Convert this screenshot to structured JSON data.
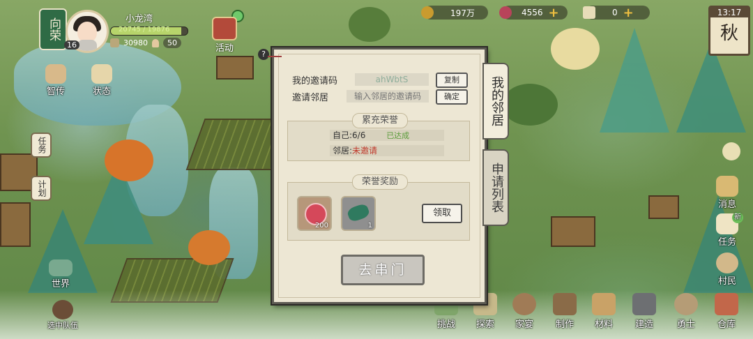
{
  "player": {
    "title": "向荣",
    "name": "小龙湾",
    "level": "16",
    "exp_text": "20745 / 19876",
    "exp_fraction": 0.92,
    "coins": "30980",
    "people": "50"
  },
  "top_resources": {
    "copper": "197万",
    "gem": "4556",
    "ticket": "0",
    "plus": "+"
  },
  "clock": {
    "time": "13:17",
    "season": "秋"
  },
  "activity_label": "活动",
  "help_label": "?",
  "left_menu": {
    "wisdom": "智传",
    "status": "状态",
    "task_tab": "任务",
    "plan_tab": "计划",
    "world": "世界",
    "team": "选中队伍"
  },
  "right_menu": {
    "message": "消息",
    "task": "任务",
    "task_badge": "新",
    "villager": "村民"
  },
  "bottom_menu": [
    "挑战",
    "探索",
    "家宴",
    "制作",
    "材料",
    "建造",
    "勇士",
    "仓库"
  ],
  "dialog": {
    "my_code_label": "我的邀请码",
    "my_code_value": "ahWbtS",
    "copy_button": "复制",
    "invite_label": "邀请邻居",
    "invite_placeholder": "输入邻居的邀请码",
    "confirm_button": "确定",
    "honor_section_title": "累充荣誉",
    "self_label": "自己:",
    "self_value": "6/6",
    "self_status": "已达成",
    "neighbor_label": "邻居:",
    "neighbor_status": "未邀请",
    "reward_section_title": "荣誉奖励",
    "rewards": [
      {
        "icon": "plum-blossom-icon",
        "count": "200"
      },
      {
        "icon": "jade-stone-icon",
        "count": "1"
      }
    ],
    "claim_button": "领取",
    "go_button": "去串门"
  },
  "side_tabs": {
    "my_neighbor": "我的邻居",
    "apply_list": "申请列表"
  },
  "colors": {
    "accent_red": "#c0392b",
    "achieved_green": "#5a9c3a",
    "gold": "#f0c040"
  }
}
